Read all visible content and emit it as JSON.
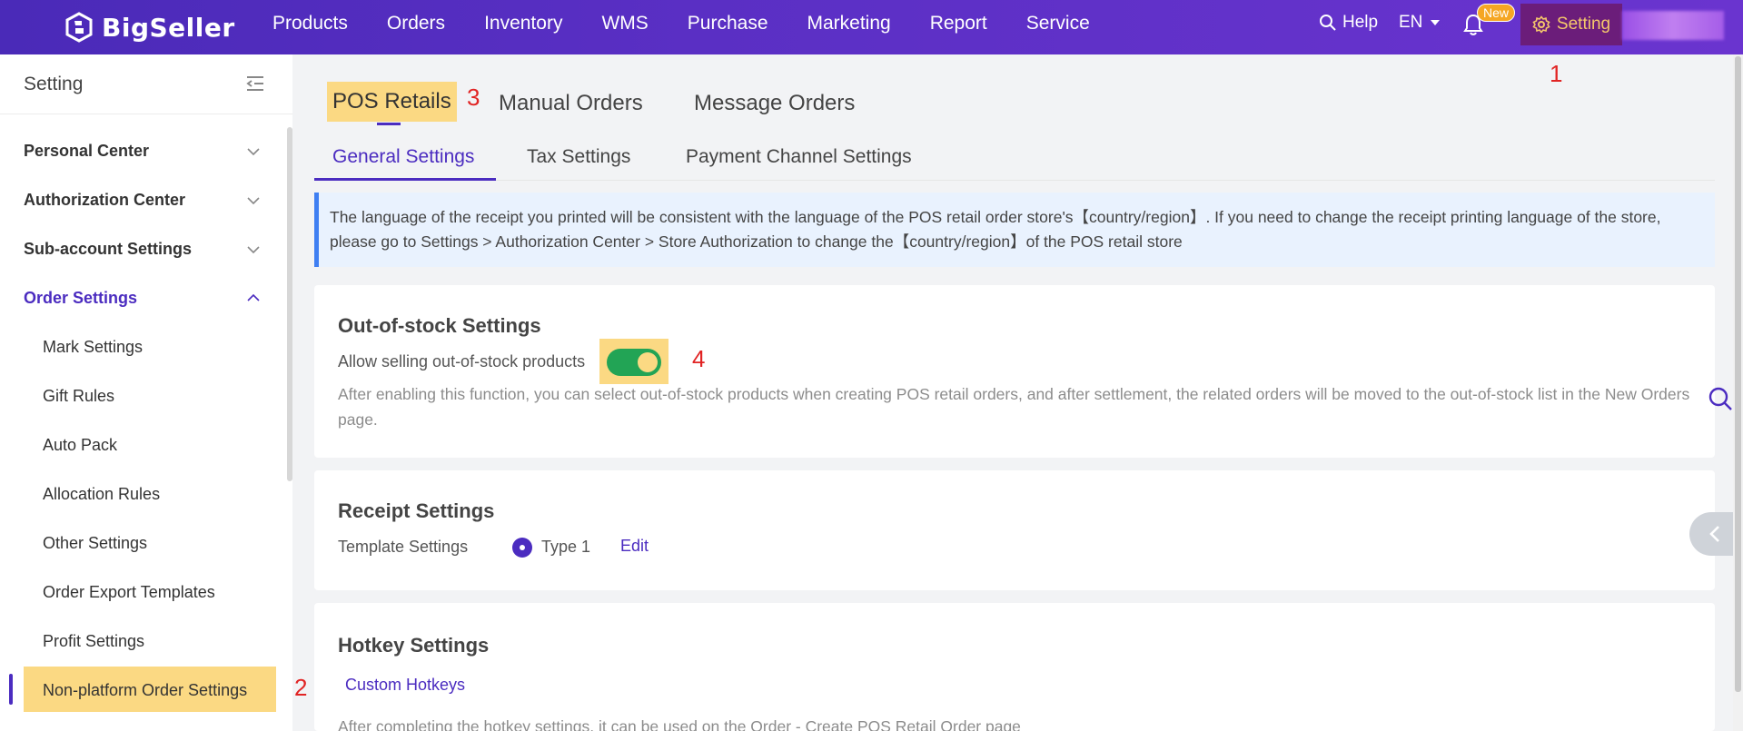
{
  "topbar": {
    "logo_text": "BigSeller",
    "nav": [
      "Products",
      "Orders",
      "Inventory",
      "WMS",
      "Purchase",
      "Marketing",
      "Report",
      "Service"
    ],
    "help_label": "Help",
    "lang_label": "EN",
    "badge_new": "New",
    "setting_label": "Setting",
    "accent_color": "#5a2fc4"
  },
  "sidebar": {
    "title": "Setting",
    "groups": [
      {
        "label": "Personal Center"
      },
      {
        "label": "Authorization Center"
      },
      {
        "label": "Sub-account Settings"
      },
      {
        "label": "Order Settings"
      }
    ],
    "order_settings_items": [
      "Mark Settings",
      "Gift Rules",
      "Auto Pack",
      "Allocation Rules",
      "Other Settings",
      "Order Export Templates",
      "Profit Settings",
      "Non-platform Order Settings"
    ]
  },
  "annotations": {
    "m1": "1",
    "m2": "2",
    "m3": "3",
    "m4": "4"
  },
  "main": {
    "top_tabs": [
      "POS Retails",
      "Manual Orders",
      "Message Orders"
    ],
    "sub_tabs": [
      "General Settings",
      "Tax Settings",
      "Payment Channel Settings"
    ],
    "notice": "The language of the receipt you printed will be consistent with the language of the POS retail order store's【country/region】. If you need to change the receipt printing language of the store, please go to Settings > Authorization Center > Store Authorization to change the【country/region】of the POS retail store",
    "out_of_stock": {
      "title": "Out-of-stock Settings",
      "label": "Allow selling out-of-stock products",
      "enabled": true,
      "description": "After enabling this function, you can select out-of-stock products when creating POS retail orders, and after settlement, the related orders will be moved to the out-of-stock list in the New Orders page."
    },
    "receipt": {
      "title": "Receipt Settings",
      "label": "Template Settings",
      "option": "Type 1",
      "edit": "Edit"
    },
    "hotkey": {
      "title": "Hotkey Settings",
      "link": "Custom Hotkeys",
      "description": "After completing the hotkey settings, it can be used on the Order - Create POS Retail Order page"
    }
  }
}
